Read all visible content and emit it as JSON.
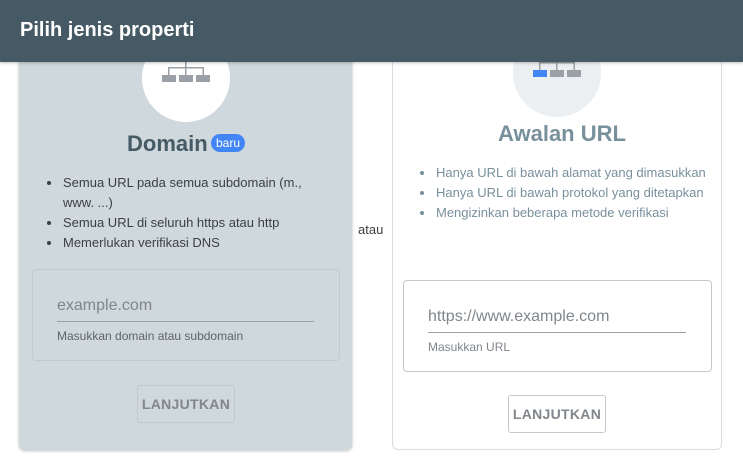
{
  "header": {
    "title": "Pilih jenis properti"
  },
  "separator": "atau",
  "domain_card": {
    "icon": "domain-tree-icon",
    "title": "Domain",
    "badge": "baru",
    "features": [
      "Semua URL pada semua subdomain (m., www. ...)",
      "Semua URL di seluruh https atau http",
      "Memerlukan verifikasi DNS"
    ],
    "input": {
      "value": "",
      "placeholder": "example.com"
    },
    "help": "Masukkan domain atau subdomain",
    "button": "LANJUTKAN"
  },
  "url_card": {
    "icon": "url-prefix-tree-icon",
    "title": "Awalan URL",
    "features": [
      "Hanya URL di bawah alamat yang dimasukkan",
      "Hanya URL di bawah protokol yang ditetapkan",
      "Mengizinkan beberapa metode verifikasi"
    ],
    "input": {
      "value": "",
      "placeholder": "https://www.example.com"
    },
    "help": "Masukkan URL",
    "button": "LANJUTKAN"
  },
  "colors": {
    "header_bg": "#455a64",
    "domain_card_bg": "#cfd8dc",
    "accent": "#4285f4"
  }
}
